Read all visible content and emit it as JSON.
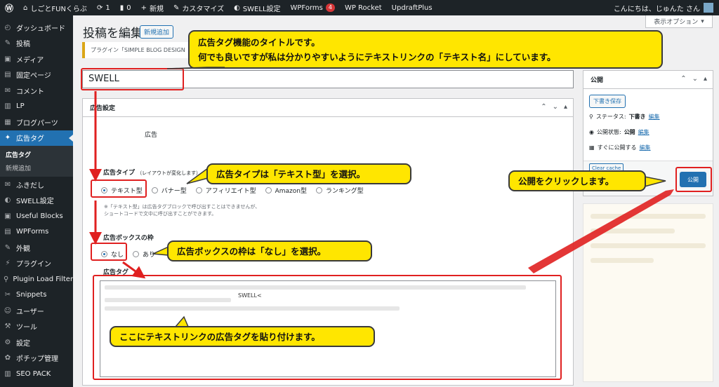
{
  "adminbar": {
    "site_name": "しごとFUNくらぶ",
    "updates": "1",
    "comments": "0",
    "new": "新規",
    "customize": "カスタマイズ",
    "swell": "SWELL設定",
    "wpforms": "WPForms",
    "wpforms_badge": "4",
    "rocket": "WP Rocket",
    "updraft": "UpdraftPlus",
    "greeting": "こんにちは、じゅんた さん"
  },
  "sidebar": {
    "items": [
      {
        "icon": "dashboard-icon",
        "glyph": "◴",
        "label": "ダッシュボード"
      },
      {
        "icon": "pin-icon",
        "glyph": "✎",
        "label": "投稿"
      },
      {
        "icon": "media-icon",
        "glyph": "▣",
        "label": "メディア"
      },
      {
        "icon": "page-icon",
        "glyph": "▤",
        "label": "固定ページ"
      },
      {
        "icon": "comment-icon",
        "glyph": "✉",
        "label": "コメント"
      },
      {
        "icon": "lp-icon",
        "glyph": "▥",
        "label": "LP"
      },
      {
        "icon": "blockparts-icon",
        "glyph": "▦",
        "label": "ブログパーツ"
      },
      {
        "icon": "adtag-icon",
        "glyph": "✦",
        "label": "広告タグ"
      }
    ],
    "sub": [
      "広告タグ",
      "新規追加"
    ],
    "items2": [
      {
        "icon": "balloon-icon",
        "glyph": "✉",
        "label": "ふきだし"
      },
      {
        "icon": "swell-icon",
        "glyph": "◐",
        "label": "SWELL設定"
      },
      {
        "icon": "blocks-icon",
        "glyph": "▣",
        "label": "Useful Blocks"
      },
      {
        "icon": "wpforms-icon",
        "glyph": "▤",
        "label": "WPForms"
      },
      {
        "icon": "appearance-icon",
        "glyph": "✎",
        "label": "外観"
      },
      {
        "icon": "plugin-icon",
        "glyph": "⚡",
        "label": "プラグイン"
      },
      {
        "icon": "filter-icon",
        "glyph": "⚲",
        "label": "Plugin Load Filter"
      },
      {
        "icon": "snippets-icon",
        "glyph": "✂",
        "label": "Snippets"
      },
      {
        "icon": "user-icon",
        "glyph": "☺",
        "label": "ユーザー"
      },
      {
        "icon": "tools-icon",
        "glyph": "⚒",
        "label": "ツール"
      },
      {
        "icon": "settings-icon",
        "glyph": "⚙",
        "label": "設定"
      },
      {
        "icon": "pochipp-icon",
        "glyph": "✿",
        "label": "ポチップ管理"
      },
      {
        "icon": "seo-icon",
        "glyph": "▥",
        "label": "SEO PACK"
      }
    ]
  },
  "screen_options": "表示オプション",
  "page": {
    "title": "投稿を編集",
    "add_new": "新規追加",
    "notice": "プラグイン「SIMPLE BLOG DESIGN",
    "post_title": "SWELL"
  },
  "adbox": {
    "header": "広告設定",
    "ad_label": "広告",
    "type_label": "広告タイプ",
    "type_hint": "（レイアウトが変化します）",
    "types": [
      "テキスト型",
      "バナー型",
      "アフィリエイト型",
      "Amazon型",
      "ランキング型"
    ],
    "type_note1": "※「テキスト型」は広告タグブロックで呼び出すことはできませんが、",
    "type_note2": "ショートコードで文中に呼び出すことができます。",
    "frame_label": "広告ボックスの枠",
    "frames": [
      "なし",
      "あり"
    ],
    "tag_label": "広告タグ",
    "tag_text": "SWELL<"
  },
  "publish": {
    "header": "公開",
    "save_draft": "下書き保存",
    "status_label": "ステータス:",
    "status": "下書き",
    "visibility_label": "公開状態:",
    "visibility": "公開",
    "schedule": "すぐに公開する",
    "edit": "編集",
    "clear_cache": "Clear cache",
    "publish_btn": "公開"
  },
  "callouts": {
    "c1_line1": "広告タグ機能のタイトルです。",
    "c1_line2": "何でも良いですが私は分かりやすいようにテキストリンクの「テキスト名」にしています。",
    "c2": "広告タイプは「テキスト型」を選択。",
    "c3": "広告ボックスの枠は「なし」を選択。",
    "c4": "ここにテキストリンクの広告タグを貼り付けます。",
    "c5": "公開をクリックします。"
  },
  "colors": {
    "accent": "#2271b1",
    "callout": "#ffe600",
    "annotation": "#e02020"
  }
}
